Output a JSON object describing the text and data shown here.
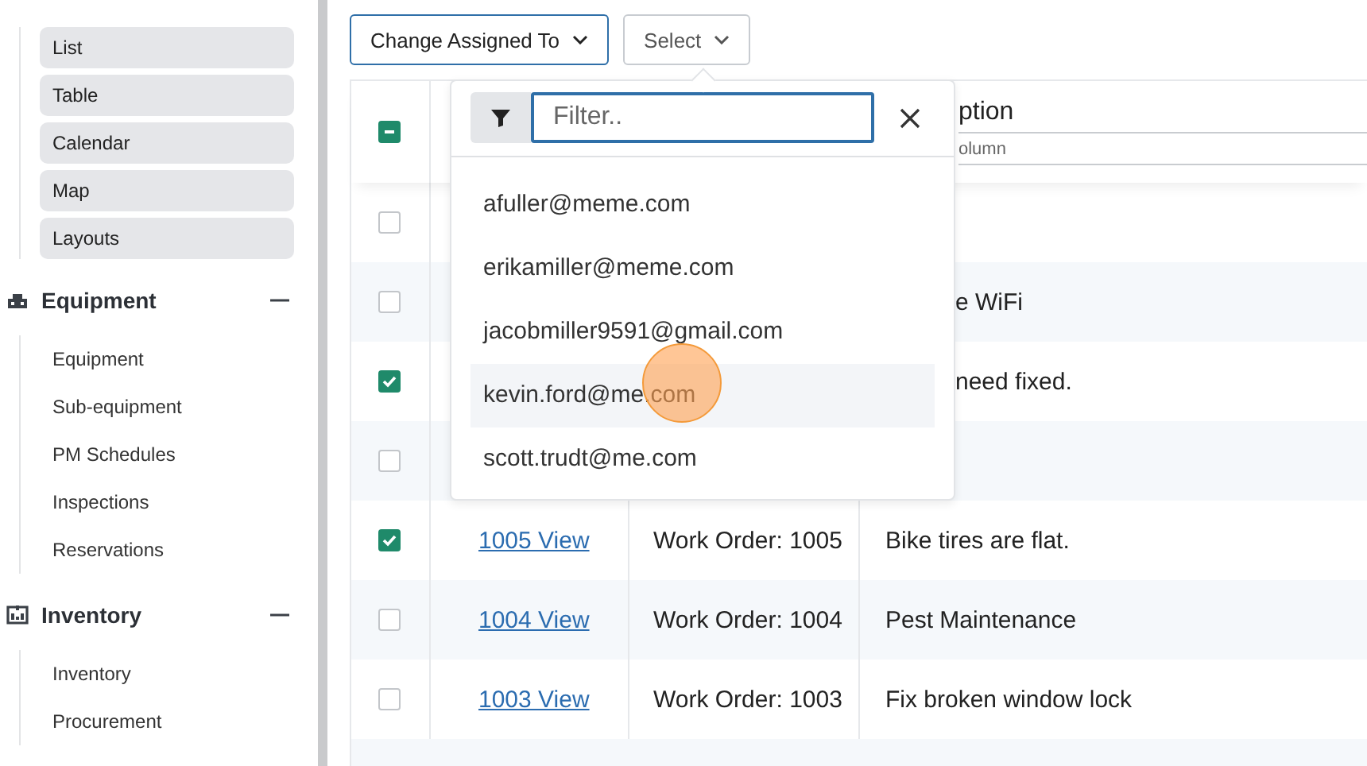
{
  "sidebar": {
    "views": [
      {
        "label": "List"
      },
      {
        "label": "Table"
      },
      {
        "label": "Calendar"
      },
      {
        "label": "Map"
      },
      {
        "label": "Layouts"
      }
    ],
    "sections": [
      {
        "title": "Equipment",
        "expanded": true,
        "items": [
          "Equipment",
          "Sub-equipment",
          "PM Schedules",
          "Inspections",
          "Reservations"
        ]
      },
      {
        "title": "Inventory",
        "expanded": true,
        "items": [
          "Inventory",
          "Procurement"
        ]
      }
    ]
  },
  "toolbar": {
    "buttons": [
      {
        "label": "Change Assigned To",
        "kind": "primary"
      },
      {
        "label": "Select",
        "kind": "default"
      }
    ]
  },
  "table": {
    "select_all_checked": true,
    "select_all_partial": true,
    "description_title": "ption",
    "description_hint": "olumn",
    "rows": [
      {
        "checked": false
      },
      {
        "checked": false,
        "description": "e WiFi"
      },
      {
        "checked": true,
        "description": "need fixed."
      },
      {
        "checked": false
      },
      {
        "checked": true,
        "link": "1005 View",
        "title": "Work Order: 1005",
        "description": "Bike tires are flat."
      },
      {
        "checked": false,
        "link": "1004 View",
        "title": "Work Order: 1004",
        "description": "Pest Maintenance"
      },
      {
        "checked": false,
        "link": "1003 View",
        "title": "Work Order: 1003",
        "description": "Fix broken window lock"
      }
    ]
  },
  "dropdown": {
    "filter": {
      "placeholder": "Filter.."
    },
    "options": [
      {
        "label": "afuller@meme.com",
        "hovered": false
      },
      {
        "label": "erikamiller@meme.com",
        "hovered": false
      },
      {
        "label": "jacobmiller9591@gmail.com",
        "hovered": false
      },
      {
        "label": "kevin.ford@me.com",
        "hovered": true
      },
      {
        "label": "scott.trudt@me.com",
        "hovered": false
      }
    ]
  }
}
